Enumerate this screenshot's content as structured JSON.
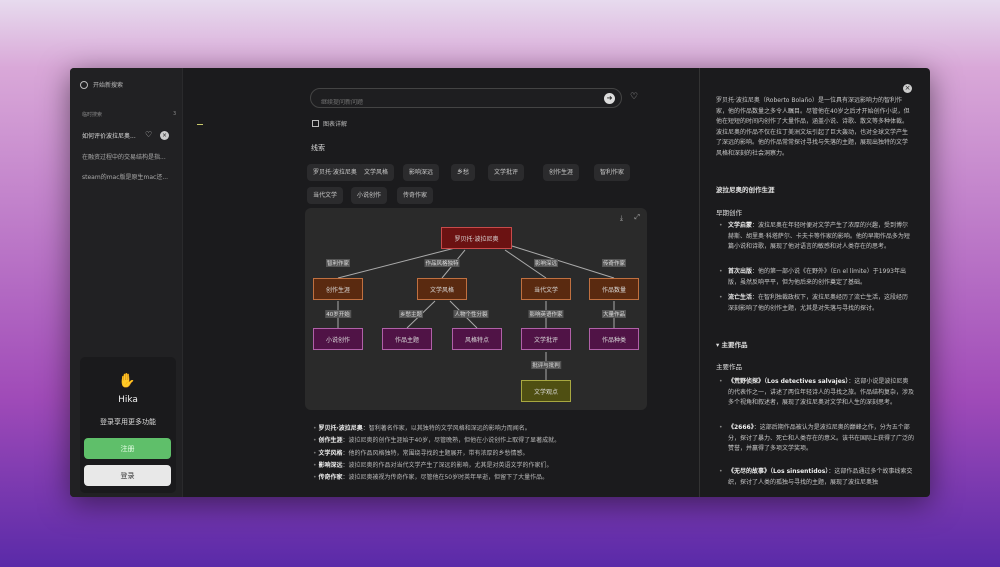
{
  "sidebar": {
    "search_placeholder": "开始新搜索",
    "history_label": "临时搜索",
    "history_count": "3",
    "items": [
      "如何评价波拉尼奥...",
      "在融资过程中的交易结构是指...",
      "steam的mac版是原生mac还..."
    ],
    "brand": "Hika",
    "login_prompt": "登录享用更多功能",
    "register": "注册",
    "login": "登录"
  },
  "main": {
    "input_placeholder": "继续提问新问题",
    "chart_toggle": "图表详解",
    "clues_label": "线索",
    "tags": [
      "罗贝托·波拉尼奥",
      "文学风格",
      "影响深远",
      "乡愁",
      "文学批评",
      "创作生涯",
      "智利作家",
      "当代文学",
      "小说创作",
      "传奇作家"
    ],
    "diagram": {
      "nodes": {
        "root": "罗贝托·波拉尼奥",
        "a": "创作生涯",
        "b": "文学风格",
        "c": "当代文学",
        "d": "作品数量",
        "a1": "小说创作",
        "b1": "作品主题",
        "b2": "风格特点",
        "c1": "文学批评",
        "d1": "作品种类",
        "c2": "文学观点"
      },
      "edges": {
        "ra": "智利作家",
        "rb": "作品风格独特",
        "rc": "影响深远",
        "rd": "传奇作家",
        "aa1": "40岁开始",
        "bb1": "乡愁主题",
        "bb2": "人物个性分裂",
        "cc1": "影响英语作家",
        "dd1": "大量作品",
        "c1c2": "批评与批判"
      }
    },
    "bullets": [
      {
        "k": "罗贝托·波拉尼奥",
        "v": "智利著名作家，以其独特的文学风格和深远的影响力而闻名。"
      },
      {
        "k": "创作生涯",
        "v": "波拉尼奥的创作生涯始于40岁，尽管晚熟，但他在小说创作上取得了显著成就。"
      },
      {
        "k": "文学风格",
        "v": "他的作品风格独特，常围绕寻找的主题展开，带有浓厚的乡愁情感。"
      },
      {
        "k": "影响深远",
        "v": "波拉尼奥的作品对当代文学产生了深远的影响，尤其是对英语文学的作家们。"
      },
      {
        "k": "传奇作家",
        "v": "波拉尼奥被视为传奇作家，尽管他在50岁时英年早逝，但留下了大量作品。"
      }
    ]
  },
  "panel": {
    "intro": "罗贝托·波拉尼奥（Roberto Bolaño）是一位具有深远影响力的智利作家，他的作品数量之多令人瞩目。尽管他在40岁之后才开始创作小说，但他在短短的时间内创作了大量作品，涵盖小说、诗歌、散文等多种体裁。波拉尼奥的作品不仅在拉丁美洲文坛引起了巨大轰动，也对全球文学产生了深远的影响。他的作品常常探讨寻找与失落的主题，展现出独特的文学风格和深刻的社会洞察力。",
    "h1": "波拉尼奥的创作生涯",
    "h2": "早期创作",
    "early": [
      {
        "k": "文学启蒙",
        "v": "波拉尼奥在年轻时便对文学产生了浓厚的兴趣，受到博尔赫斯、胡里奥·科塔萨尔、卡夫卡等作家的影响。他的早期作品多为短篇小说和诗歌，展现了他对语言的敏感和对人类存在的思考。"
      },
      {
        "k": "首次出版",
        "v": "他的第一部小说《在野外》（En el límite）于1993年出版，虽然反响平平，但为他后来的创作奠定了基础。"
      },
      {
        "k": "流亡生活",
        "v": "在智利独裁政权下，波拉尼奥经历了流亡生活，这段经历深刻影响了他的创作主题，尤其是对失落与寻找的探讨。"
      }
    ],
    "toggle": "▾ 主要作品",
    "h3": "主要作品",
    "works": [
      {
        "k": "《荒野侦探》（Los detectives salvajes）",
        "v": "这部小说是波拉尼奥的代表作之一，讲述了两位年轻诗人的寻找之旅。作品结构复杂，涉及多个视角和叙述者，展现了波拉尼奥对文学和人生的深刻思考。"
      },
      {
        "k": "《2666》",
        "v": "这部后期作品被认为是波拉尼奥的巅峰之作，分为五个部分，探讨了暴力、死亡和人类存在的意义。该书在国际上获得了广泛的赞誉，并赢得了多项文学奖项。"
      },
      {
        "k": "《无尽的故事》（Los sinsentidos）",
        "v": "这部作品通过多个故事线索交织，探讨了人类的孤独与寻找的主题，展现了波拉尼奥独"
      }
    ]
  }
}
